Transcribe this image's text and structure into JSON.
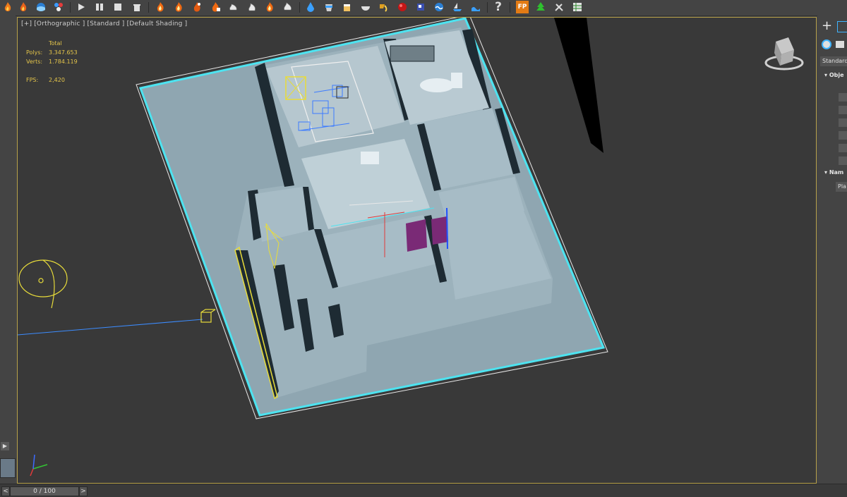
{
  "viewport": {
    "label": "[+] [Orthographic ] [Standard ] [Default Shading ]",
    "stats": {
      "header": "Total",
      "polys_label": "Polys:",
      "polys_value": "3.347.653",
      "verts_label": "Verts:",
      "verts_value": "1.784.119",
      "fps_label": "FPS:",
      "fps_value": "2,420"
    }
  },
  "toolbar": {
    "icons": [
      "fire-icon",
      "water-icon",
      "particles-icon",
      "play-icon",
      "pause-icon",
      "stop-icon",
      "trash-icon",
      "fire-sim-icon",
      "fire-sim-icon-2",
      "fire-sim-icon-3",
      "smoke-icon",
      "smoke-icon-2",
      "fire-sim-icon-4",
      "smoke-icon-3",
      "liquid-icon",
      "bucket-icon",
      "cup-icon",
      "bowl-icon",
      "pour-icon",
      "sphere-icon",
      "cube-icon",
      "wave-icon",
      "boat-icon",
      "waves-icon",
      "help-icon",
      "fp-icon",
      "tree-icon",
      "tools-icon",
      "table-icon"
    ],
    "help_label": "?",
    "fp_label": "FP"
  },
  "right_panel": {
    "plus_label": "+",
    "dropdown": "Standard",
    "section_1": "Obje",
    "section_2": "Nam",
    "name_field": "Pla"
  },
  "timeline": {
    "frame": "0 / 100",
    "prev_label": "<",
    "next_label": ">"
  },
  "colors": {
    "selection": "#4de3f0",
    "floor": "#8fa6b1",
    "wall_top": "#a7bcc6",
    "wall_dark": "#1e2b33",
    "purple": "#7a2a76",
    "helper": "#e8dc3a",
    "stats": "#e3c44a",
    "viewport_border": "#b8a24a"
  }
}
